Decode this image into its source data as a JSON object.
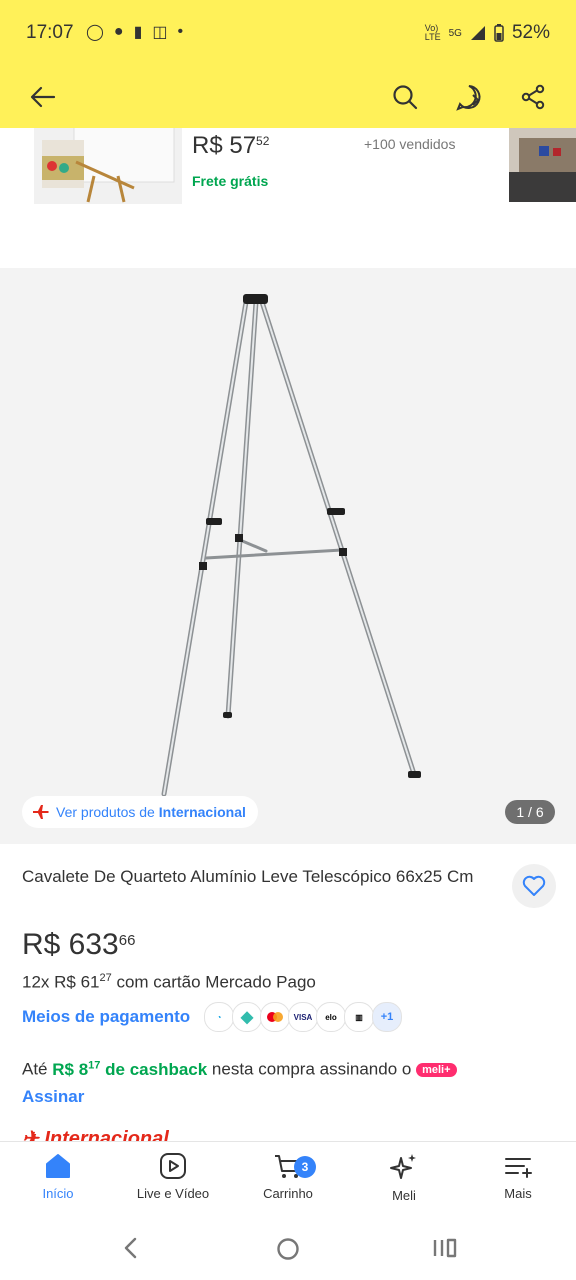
{
  "status_bar": {
    "time": "17:07",
    "network": "5G",
    "battery": "52%"
  },
  "related": {
    "price_int": "R$ 57",
    "price_cents": "52",
    "sold": "+100 vendidos",
    "shipping": "Frete grátis"
  },
  "gallery": {
    "international_prefix": "Ver produtos de ",
    "international_brand": "Internacional",
    "counter": "1 / 6"
  },
  "product": {
    "title": "Cavalete De Quarteto Alumínio Leve Telescópico 66x25 Cm",
    "price_int": "R$ 633",
    "price_cents": "66",
    "installments_prefix": "12x R$ 61",
    "installments_cents": "27",
    "installments_suffix": " com cartão Mercado Pago",
    "payment_methods_link": "Meios de pagamento",
    "payment_icons": [
      "mercado-pago",
      "pix",
      "mastercard",
      "VISA",
      "elo",
      "boleto"
    ],
    "payment_more": "+1",
    "cashback_prefix": "Até ",
    "cashback_value": "R$ 8",
    "cashback_cents": "17",
    "cashback_text": " de cashback",
    "cashback_suffix": " nesta compra assinando o ",
    "meli_plus": "meli+",
    "subscribe": "Assinar",
    "international_section": "Internacional"
  },
  "bottom_nav": [
    {
      "label": "Início",
      "icon": "home-icon",
      "active": true
    },
    {
      "label": "Live e Vídeo",
      "icon": "play-icon",
      "active": false
    },
    {
      "label": "Carrinho",
      "icon": "cart-icon",
      "active": false,
      "badge": "3"
    },
    {
      "label": "Meli",
      "icon": "sparkle-icon",
      "active": false
    },
    {
      "label": "Mais",
      "icon": "menu-icon",
      "active": false
    }
  ],
  "colors": {
    "brand_yellow": "#fff159",
    "link_blue": "#3483fa",
    "success_green": "#00a650",
    "intl_red": "#e4281a"
  }
}
